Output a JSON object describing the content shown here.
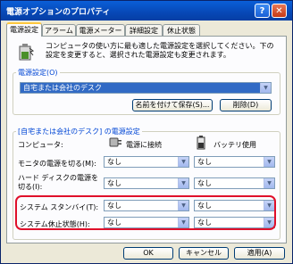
{
  "window": {
    "title": "電源オプションのプロパティ",
    "help_symbol": "?",
    "close_symbol": "✕"
  },
  "tabs": [
    {
      "label": "電源設定",
      "active": true
    },
    {
      "label": "アラーム",
      "active": false
    },
    {
      "label": "電源メーター",
      "active": false
    },
    {
      "label": "詳細設定",
      "active": false
    },
    {
      "label": "休止状態",
      "active": false
    }
  ],
  "description": "コンピュータの使い方に最も適した電源設定を選択してください。下の設定を変更すると、選択された電源設定も変更されます。",
  "scheme": {
    "group_label": "電源設定(O)",
    "selected": "自宅または会社のデスク",
    "save_as_label": "名前を付けて保存(S)...",
    "delete_label": "削除(D)"
  },
  "settings": {
    "group_label": "[自宅または会社のデスク] の電源設定",
    "computer_label": "コンピュータ:",
    "ac_label": "電源に接続",
    "battery_label": "バッテリ使用",
    "rows": [
      {
        "label": "モニタの電源を切る(M):",
        "ac": "なし",
        "battery": "なし"
      },
      {
        "label": "ハード ディスクの電源を切る(I):",
        "ac": "なし",
        "battery": "なし"
      },
      {
        "label": "システム スタンバイ(T):",
        "ac": "なし",
        "battery": "なし"
      },
      {
        "label": "システム休止状態(H):",
        "ac": "なし",
        "battery": "なし"
      }
    ]
  },
  "footer": {
    "ok_label": "OK",
    "cancel_label": "キャンセル",
    "apply_label": "適用(A)"
  },
  "colors": {
    "titlebar": "#0748b6",
    "group_label": "#0046d5",
    "highlight_box": "#e0102a",
    "selection": "#316ac5"
  }
}
